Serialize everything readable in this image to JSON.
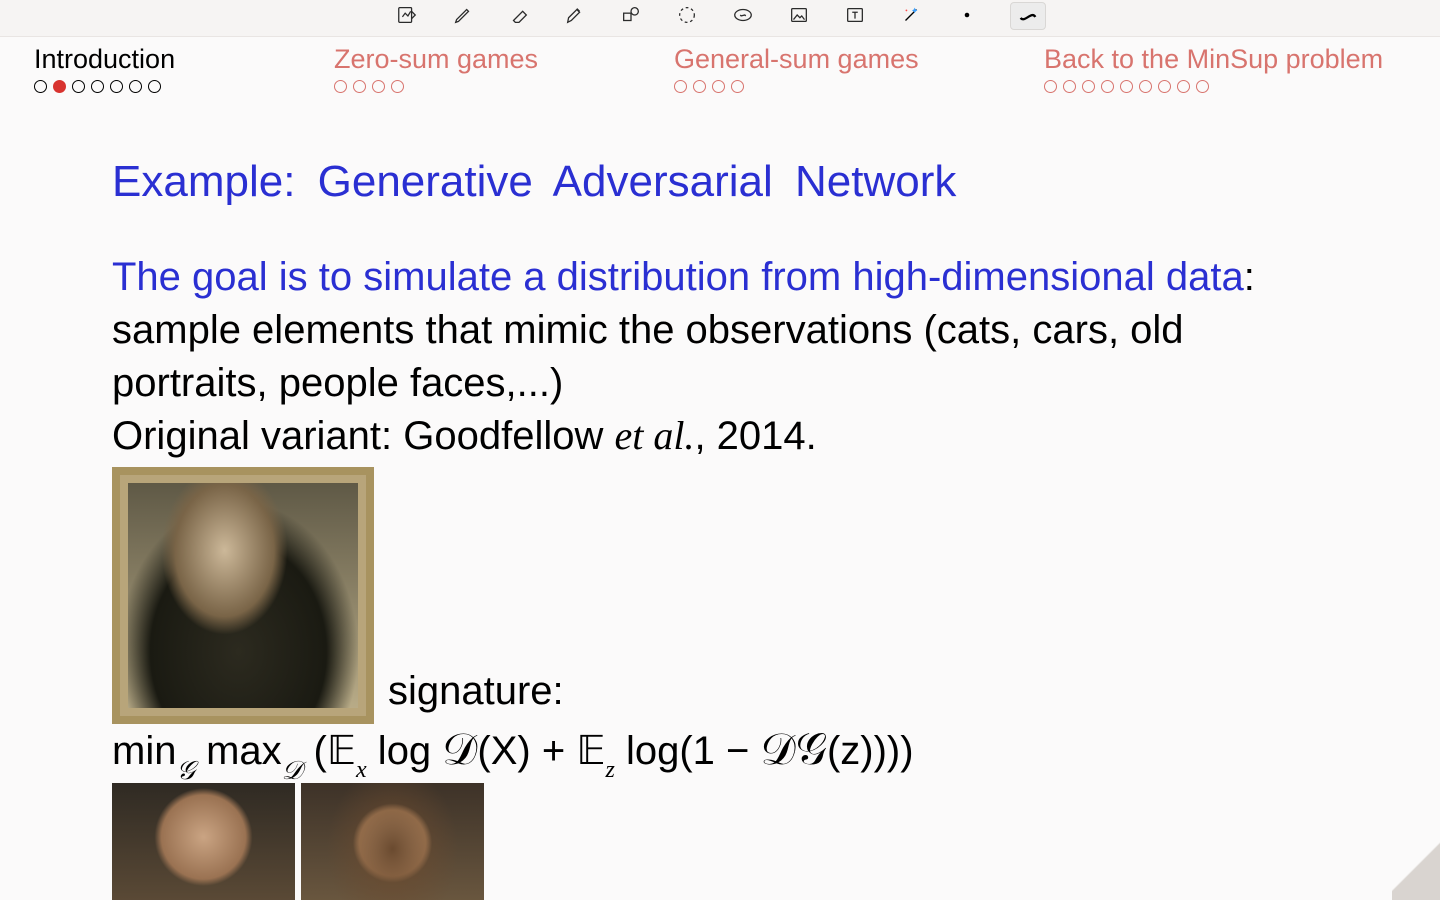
{
  "toolbar": {
    "tools": [
      "insert-page-icon",
      "pencil-icon",
      "eraser-icon",
      "highlighter-icon",
      "shapes-icon",
      "lasso-icon",
      "sticker-icon",
      "image-icon",
      "text-icon",
      "magic-icon",
      "dot-size-icon",
      "stroke-swatch-icon"
    ]
  },
  "nav": [
    {
      "label": "Introduction",
      "dots": 7,
      "filled_index": 1,
      "active": true
    },
    {
      "label": "Zero-sum games",
      "dots": 4,
      "filled_index": -1,
      "active": false
    },
    {
      "label": "General-sum games",
      "dots": 4,
      "filled_index": -1,
      "active": false
    },
    {
      "label": "Back to the MinSup problem",
      "dots": 9,
      "filled_index": -1,
      "active": false
    }
  ],
  "slide": {
    "title": "Example:  Generative Adversarial Network",
    "lead_blue": "The goal is to simulate a distribution from high-dimensional data",
    "lead_colon": ":",
    "lead_rest": " sample elements that mimic the observations (cats, cars, old portraits, people faces,...)",
    "orig_prefix": "Original variant: Goodfellow ",
    "orig_ital": "et al.",
    "orig_suffix": ", 2014.",
    "signature_label": "signature:",
    "formula_plain": "min_G max_D ( E_x log D(X) + E_z log(1 − D G(z)) ) )",
    "images": {
      "portrait_alt": "GAN-generated classical portrait in gilt frame",
      "face1_alt": "GAN-generated male face",
      "face2_alt": "GAN-generated female face"
    }
  }
}
